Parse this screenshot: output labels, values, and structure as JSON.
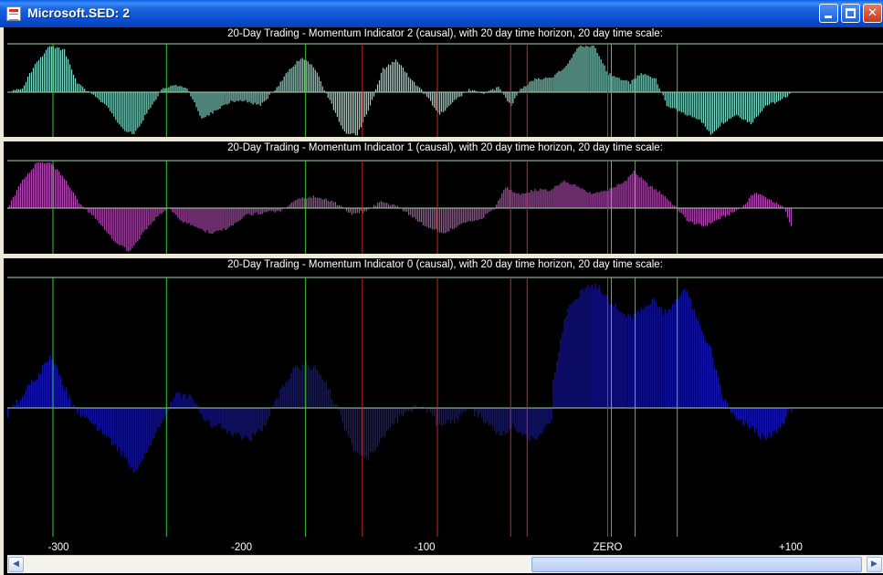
{
  "window": {
    "title": "Microsoft.SED: 2"
  },
  "colors": {
    "panel2_series": "#7FD8C8",
    "panel1_series": "#B04AB0",
    "panel0_series": "#1414A8",
    "green_line": "#3CC83C",
    "red_line": "#C82828",
    "guide_line": "#A8D4A8"
  },
  "panels": [
    {
      "title": "20-Day Trading - Momentum Indicator 2 (causal), with 20 day time horizon, 20 day time scale:"
    },
    {
      "title": "20-Day Trading - Momentum Indicator 1 (causal), with 20 day time horizon, 20 day time scale:"
    },
    {
      "title": "20-Day Trading - Momentum Indicator 0 (causal), with 20 day time horizon, 20 day time scale:"
    }
  ],
  "chart_data": {
    "type": "bar",
    "x_axis": {
      "ticks": [
        -300,
        -200,
        -100,
        0,
        100
      ],
      "tick_labels": [
        "-300",
        "-200",
        "-100",
        "ZERO",
        "+100"
      ],
      "range": [
        -328,
        148
      ]
    },
    "green_markers": [
      -303,
      -241,
      -165,
      2,
      15,
      38
    ],
    "red_markers": [
      -134,
      -93,
      -53,
      -44,
      0
    ],
    "series": [
      {
        "type": "bar",
        "panel": 2,
        "knots": [
          [
            -328,
            0
          ],
          [
            -320,
            0.1
          ],
          [
            -313,
            0.6
          ],
          [
            -305,
            1.0
          ],
          [
            -297,
            0.9
          ],
          [
            -290,
            0.2
          ],
          [
            -282,
            -0.05
          ],
          [
            -274,
            -0.3
          ],
          [
            -266,
            -0.8
          ],
          [
            -259,
            -0.95
          ],
          [
            -251,
            -0.4
          ],
          [
            -244,
            0.05
          ],
          [
            -238,
            0.15
          ],
          [
            -230,
            0.1
          ],
          [
            -222,
            -0.6
          ],
          [
            -214,
            -0.4
          ],
          [
            -206,
            -0.2
          ],
          [
            -198,
            -0.2
          ],
          [
            -190,
            -0.3
          ],
          [
            -182,
            0.05
          ],
          [
            -174,
            0.5
          ],
          [
            -167,
            0.75
          ],
          [
            -160,
            0.5
          ],
          [
            -152,
            -0.2
          ],
          [
            -144,
            -0.9
          ],
          [
            -137,
            -0.95
          ],
          [
            -130,
            -0.3
          ],
          [
            -123,
            0.5
          ],
          [
            -116,
            0.7
          ],
          [
            -108,
            0.3
          ],
          [
            -100,
            -0.05
          ],
          [
            -92,
            -0.5
          ],
          [
            -84,
            -0.2
          ],
          [
            -76,
            0.05
          ],
          [
            -68,
            -0.05
          ],
          [
            -60,
            0.1
          ],
          [
            -53,
            -0.3
          ],
          [
            -48,
            0.05
          ],
          [
            -40,
            0.3
          ],
          [
            -32,
            0.3
          ],
          [
            -24,
            0.5
          ],
          [
            -16,
            1.0
          ],
          [
            -8,
            1.0
          ],
          [
            0,
            0.4
          ],
          [
            6,
            0.3
          ],
          [
            12,
            0.2
          ],
          [
            18,
            0.4
          ],
          [
            26,
            0.3
          ],
          [
            32,
            -0.3
          ],
          [
            42,
            -0.5
          ],
          [
            50,
            -0.6
          ],
          [
            56,
            -0.95
          ],
          [
            62,
            -0.7
          ],
          [
            70,
            -0.5
          ],
          [
            78,
            -0.7
          ],
          [
            86,
            -0.3
          ],
          [
            94,
            -0.2
          ],
          [
            100,
            0
          ]
        ]
      },
      {
        "type": "bar",
        "panel": 1,
        "knots": [
          [
            -328,
            0
          ],
          [
            -320,
            0.6
          ],
          [
            -312,
            1.0
          ],
          [
            -305,
            1.0
          ],
          [
            -296,
            0.6
          ],
          [
            -288,
            0.05
          ],
          [
            -278,
            -0.3
          ],
          [
            -270,
            -0.7
          ],
          [
            -262,
            -0.95
          ],
          [
            -255,
            -0.6
          ],
          [
            -246,
            -0.15
          ],
          [
            -240,
            0.0
          ],
          [
            -232,
            -0.3
          ],
          [
            -224,
            -0.45
          ],
          [
            -216,
            -0.55
          ],
          [
            -208,
            -0.45
          ],
          [
            -198,
            -0.15
          ],
          [
            -188,
            -0.1
          ],
          [
            -178,
            -0.05
          ],
          [
            -170,
            0.2
          ],
          [
            -160,
            0.25
          ],
          [
            -150,
            0.15
          ],
          [
            -140,
            -0.15
          ],
          [
            -132,
            -0.05
          ],
          [
            -124,
            0.15
          ],
          [
            -116,
            0.05
          ],
          [
            -108,
            -0.15
          ],
          [
            -100,
            -0.4
          ],
          [
            -90,
            -0.55
          ],
          [
            -80,
            -0.35
          ],
          [
            -70,
            -0.25
          ],
          [
            -62,
            0.0
          ],
          [
            -56,
            0.45
          ],
          [
            -48,
            0.3
          ],
          [
            -40,
            0.4
          ],
          [
            -32,
            0.4
          ],
          [
            -24,
            0.6
          ],
          [
            -16,
            0.45
          ],
          [
            -8,
            0.3
          ],
          [
            0,
            0.4
          ],
          [
            8,
            0.55
          ],
          [
            14,
            0.8
          ],
          [
            22,
            0.5
          ],
          [
            30,
            0.3
          ],
          [
            36,
            0.05
          ],
          [
            44,
            -0.3
          ],
          [
            52,
            -0.4
          ],
          [
            60,
            -0.25
          ],
          [
            68,
            -0.1
          ],
          [
            74,
            0.05
          ],
          [
            80,
            0.35
          ],
          [
            88,
            0.2
          ],
          [
            96,
            0.0
          ],
          [
            100,
            -0.4
          ]
        ]
      },
      {
        "type": "bar",
        "panel": 0,
        "knots": [
          [
            -328,
            -0.05
          ],
          [
            -320,
            0.1
          ],
          [
            -312,
            0.25
          ],
          [
            -304,
            0.4
          ],
          [
            -298,
            0.2
          ],
          [
            -292,
            0.0
          ],
          [
            -284,
            -0.1
          ],
          [
            -276,
            -0.2
          ],
          [
            -266,
            -0.35
          ],
          [
            -258,
            -0.5
          ],
          [
            -250,
            -0.3
          ],
          [
            -242,
            -0.05
          ],
          [
            -236,
            0.1
          ],
          [
            -228,
            0.1
          ],
          [
            -220,
            -0.1
          ],
          [
            -212,
            -0.15
          ],
          [
            -204,
            -0.2
          ],
          [
            -196,
            -0.25
          ],
          [
            -188,
            -0.15
          ],
          [
            -180,
            0.1
          ],
          [
            -172,
            0.3
          ],
          [
            -164,
            0.35
          ],
          [
            -156,
            0.25
          ],
          [
            -148,
            0.0
          ],
          [
            -140,
            -0.3
          ],
          [
            -132,
            -0.4
          ],
          [
            -124,
            -0.25
          ],
          [
            -116,
            -0.1
          ],
          [
            -108,
            0.0
          ],
          [
            -100,
            0.0
          ],
          [
            -92,
            -0.15
          ],
          [
            -84,
            -0.1
          ],
          [
            -76,
            0.0
          ],
          [
            -68,
            -0.1
          ],
          [
            -60,
            -0.2
          ],
          [
            -52,
            -0.15
          ],
          [
            -44,
            -0.25
          ],
          [
            -36,
            -0.2
          ],
          [
            -31,
            -0.1
          ],
          [
            -30,
            0.2
          ],
          [
            -24,
            0.7
          ],
          [
            -18,
            0.85
          ],
          [
            -12,
            0.95
          ],
          [
            -6,
            0.95
          ],
          [
            0,
            0.85
          ],
          [
            6,
            0.75
          ],
          [
            12,
            0.7
          ],
          [
            18,
            0.75
          ],
          [
            24,
            0.85
          ],
          [
            30,
            0.75
          ],
          [
            36,
            0.8
          ],
          [
            42,
            0.95
          ],
          [
            48,
            0.7
          ],
          [
            56,
            0.45
          ],
          [
            62,
            0.1
          ],
          [
            70,
            -0.1
          ],
          [
            78,
            -0.15
          ],
          [
            86,
            -0.25
          ],
          [
            94,
            -0.15
          ],
          [
            100,
            0
          ]
        ]
      }
    ]
  }
}
